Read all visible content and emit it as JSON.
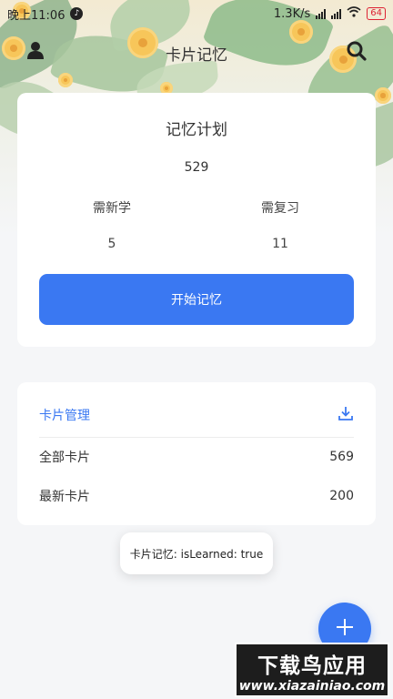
{
  "status_bar": {
    "time": "晚上11:06",
    "net_speed": "1.3K/s",
    "battery": "64"
  },
  "app_bar": {
    "title": "卡片记忆"
  },
  "plan": {
    "title": "记忆计划",
    "total": "529",
    "new_label": "需新学",
    "new_value": "5",
    "review_label": "需复习",
    "review_value": "11",
    "start_button": "开始记忆"
  },
  "manage": {
    "title": "卡片管理",
    "rows": [
      {
        "label": "全部卡片",
        "value": "569"
      },
      {
        "label": "最新卡片",
        "value": "200"
      }
    ]
  },
  "toast": {
    "text": "卡片记忆: isLearned: true"
  },
  "watermark": {
    "title": "下载鸟应用",
    "url": "www.xiazainiao.com"
  },
  "colors": {
    "accent": "#3a78f2",
    "card": "#ffffff",
    "background": "#f5f6f8"
  },
  "icons": {
    "user": "user-icon",
    "search": "search-icon",
    "download": "download-icon",
    "add": "plus-icon"
  }
}
